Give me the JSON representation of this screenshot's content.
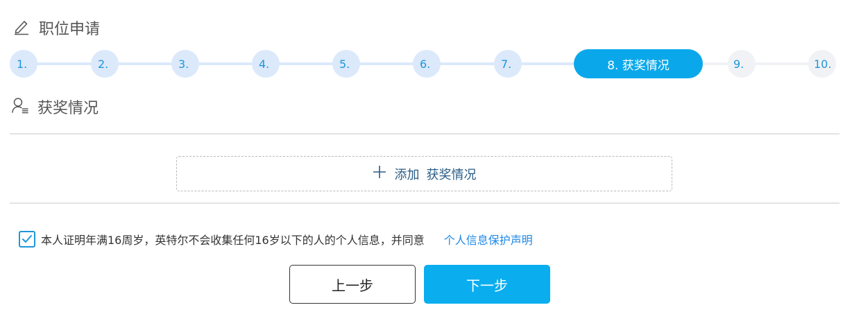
{
  "header": {
    "title": "职位申请",
    "icon": "pencil-icon"
  },
  "stepper": {
    "steps": [
      {
        "label": "1.",
        "state": "done"
      },
      {
        "label": "2.",
        "state": "done"
      },
      {
        "label": "3.",
        "state": "done"
      },
      {
        "label": "4.",
        "state": "done"
      },
      {
        "label": "5.",
        "state": "done"
      },
      {
        "label": "6.",
        "state": "done"
      },
      {
        "label": "7.",
        "state": "done"
      },
      {
        "label": "8. 获奖情况",
        "state": "active"
      },
      {
        "label": "9.",
        "state": "todo"
      },
      {
        "label": "10.",
        "state": "todo"
      }
    ]
  },
  "section": {
    "title": "获奖情况",
    "icon": "user-list-icon"
  },
  "add_button": {
    "action": "添加",
    "target": "获奖情况"
  },
  "consent": {
    "checked": true,
    "text": "本人证明年满16周岁，英特尔不会收集任何16岁以下的人的个人信息，并同意",
    "link": "个人信息保护声明"
  },
  "buttons": {
    "prev": "上一步",
    "next": "下一步"
  },
  "colors": {
    "accent": "#0aa8ea",
    "step_done_bg": "#dbe9fb",
    "step_todo_bg": "#f0f2f5",
    "link": "#1e88e5"
  }
}
